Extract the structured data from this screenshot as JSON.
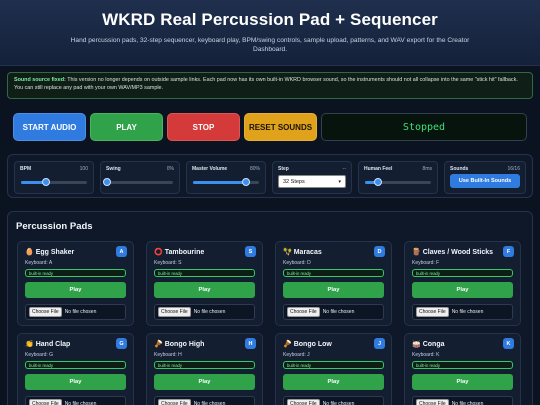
{
  "header": {
    "title": "WKRD Real Percussion Pad + Sequencer",
    "subtitle": "Hand percussion pads, 32-step sequencer, keyboard play, BPM/swing controls, sample upload, patterns, and WAV export for the Creator Dashboard."
  },
  "notice": {
    "label": "Sound source fixed:",
    "text": "This version no longer depends on outside sample links. Each pad now has its own built-in WKRD browser sound, so the instruments should not all collapse into the same \"stick hit\" fallback. You can still replace any pad with your own WAV/MP3 sample."
  },
  "transport": {
    "start_label": "START AUDIO",
    "play_label": "PLAY",
    "stop_label": "STOP",
    "reset_label": "RESET SOUNDS",
    "status": "Stopped",
    "colors": {
      "start": "#2f7be0",
      "play": "#2fa24a",
      "stop": "#d43a3a",
      "reset": "#e0a21a",
      "status_text": "#3ee07a"
    }
  },
  "controls": {
    "bpm": {
      "label": "BPM",
      "value": "100",
      "level": 0.38
    },
    "swing": {
      "label": "Swing",
      "value": "0%",
      "level": 0.0
    },
    "master": {
      "label": "Master Volume",
      "value": "80%",
      "level": 0.8
    },
    "step": {
      "label": "Step",
      "value": "--",
      "selected": "32 Steps"
    },
    "human": {
      "label": "Human Feel",
      "value": "8ms",
      "level": 0.2
    },
    "sounds": {
      "label": "Sounds",
      "value": "16/16",
      "button_label": "Use Built-In Sounds"
    }
  },
  "pads_section": {
    "title": "Percussion Pads",
    "play_label": "Play",
    "badge_label": "built-in ready",
    "file_button": "Choose File",
    "file_status": "No file chosen",
    "pads": [
      {
        "icon": "🥚",
        "name": "Egg Shaker",
        "keyboard": "Keyboard: A",
        "key": "A"
      },
      {
        "icon": "⭕",
        "name": "Tambourine",
        "keyboard": "Keyboard: S",
        "key": "S"
      },
      {
        "icon": "🪇",
        "name": "Maracas",
        "keyboard": "Keyboard: D",
        "key": "D"
      },
      {
        "icon": "🪵",
        "name": "Claves / Wood Sticks",
        "keyboard": "Keyboard: F",
        "key": "F"
      },
      {
        "icon": "👏",
        "name": "Hand Clap",
        "keyboard": "Keyboard: G",
        "key": "G"
      },
      {
        "icon": "🪘",
        "name": "Bongo High",
        "keyboard": "Keyboard: H",
        "key": "H"
      },
      {
        "icon": "🪘",
        "name": "Bongo Low",
        "keyboard": "Keyboard: J",
        "key": "J"
      },
      {
        "icon": "🥁",
        "name": "Conga",
        "keyboard": "Keyboard: K",
        "key": "K"
      }
    ]
  }
}
